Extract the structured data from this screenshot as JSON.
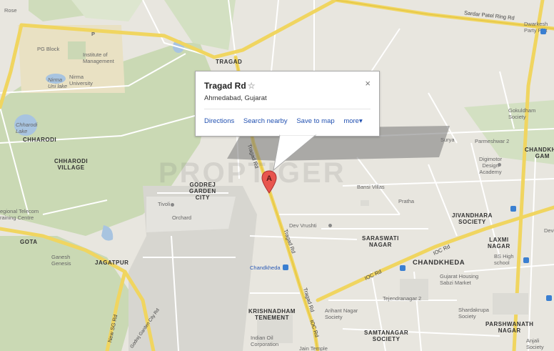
{
  "info_window": {
    "title": "Tragad Rd",
    "address": "Ahmedabad, Gujarat",
    "links": [
      "Directions",
      "Search nearby",
      "Save to map",
      "more▾"
    ],
    "close_symbol": "×",
    "star_symbol": "☆"
  },
  "marker_label": "A",
  "watermark": "PROPTIGER",
  "roads": {
    "sardar_patel": "Sardar Patel Ring Rd",
    "tragad_rd": "Tragad Rd",
    "ioc_rd": "IOC Rd",
    "sg_rd": "New SG Rd",
    "garden_city": "Godrej Garden City Rd"
  },
  "areas": {
    "tragad": "TRAGAD",
    "chharodi": "CHHARODI",
    "chharodi_village": "CHHARODI\nVILLAGE",
    "godrej": "GODREJ\nGARDEN\nCITY",
    "gota": "GOTA",
    "jagatpur": "JAGATPUR",
    "chandkheda": "CHANDKHEDA",
    "jivandhara": "JIVANDHARA\nSOCIETY",
    "saraswati": "SARASWATI\nNAGAR",
    "krishnadham": "KRISHNADHAM\nTENEMENT",
    "samtanagar": "SAMTANAGAR\nSOCIETY",
    "laxmi": "LAXMI\nNAGAR",
    "parshwanath": "PARSHWANATH\nNAGAR",
    "chandkheda_gam": "CHANDKHE\nGAM"
  },
  "pois": {
    "rose": "Rose",
    "p": "P",
    "pg_block": "PG Block",
    "institute": "Institute of\nManagement",
    "nirma_lake": "Nirma\nUni lake",
    "nirma_uni": "Nirma\nUniversity",
    "chharodi_lake": "Chharodi\nLake",
    "tivoli": "Tivoli",
    "orchard": "Orchard",
    "telecom": "egional Telecom\nraining Centre",
    "ganesh": "Ganesh\nGenesis",
    "dev_vrushti": "Dev Vrushti",
    "bansi": "Bansi Villas",
    "pratha": "Pratha",
    "surya": "Surya",
    "parmeshwar": "Parmeshwar 2",
    "digimotor": "Digimotor\nDesign\nAcademy",
    "gokuldham": "Gokuldham\nSociety",
    "dwarkesh": "Dwarkesh\nParty Plot",
    "chandkheda_st": "Chandkheda",
    "bs_high": "BS High\nschool",
    "gujarat_housing": "Gujarat Housing\nSabzi Market",
    "tejendranagar": "Tejendranagar 2",
    "arihant": "Arihant Nagar\nSociety",
    "shardakrupa": "Shardakrupa\nSociety",
    "indian_oil": "Indian Oil\nCorporation",
    "jain_temple": "Jain Temple",
    "anjali": "Anjali\nSociety",
    "devi": "Devi"
  }
}
